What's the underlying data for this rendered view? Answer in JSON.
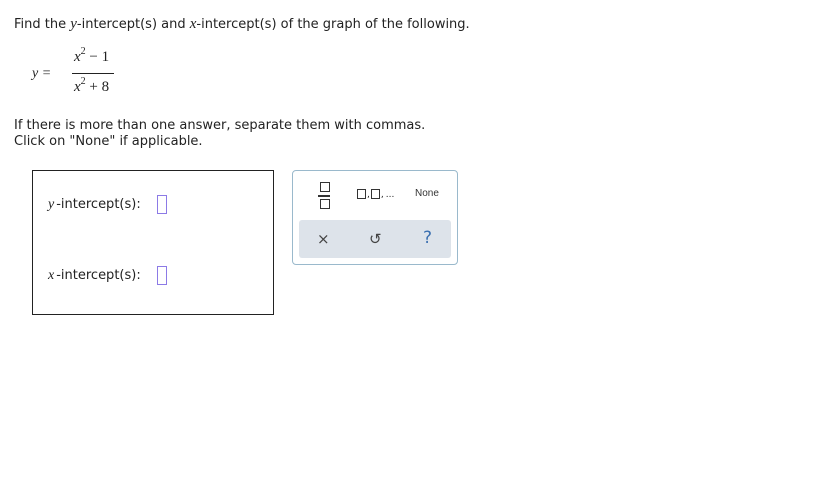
{
  "prompt": {
    "part1": "Find the ",
    "y_var": "y",
    "part2": "-intercept(s) and ",
    "x_var": "x",
    "part3": "-intercept(s) of the graph of the following."
  },
  "equation": {
    "lhs": "y =",
    "num_base": "x",
    "num_exp": "2",
    "num_rest": " − 1",
    "den_base": "x",
    "den_exp": "2",
    "den_rest": " + 8"
  },
  "instructions": {
    "line1": "If there is more than one answer, separate them with commas.",
    "line2": "Click on \"None\" if applicable."
  },
  "answers": {
    "y_var": "y",
    "y_label": "-intercept(s):",
    "x_var": "x",
    "x_label": "-intercept(s):"
  },
  "palette": {
    "list_comma": ",",
    "list_dots": "...",
    "none_label": "None",
    "clear_icon": "×",
    "undo_icon": "↺",
    "help_icon": "?"
  }
}
